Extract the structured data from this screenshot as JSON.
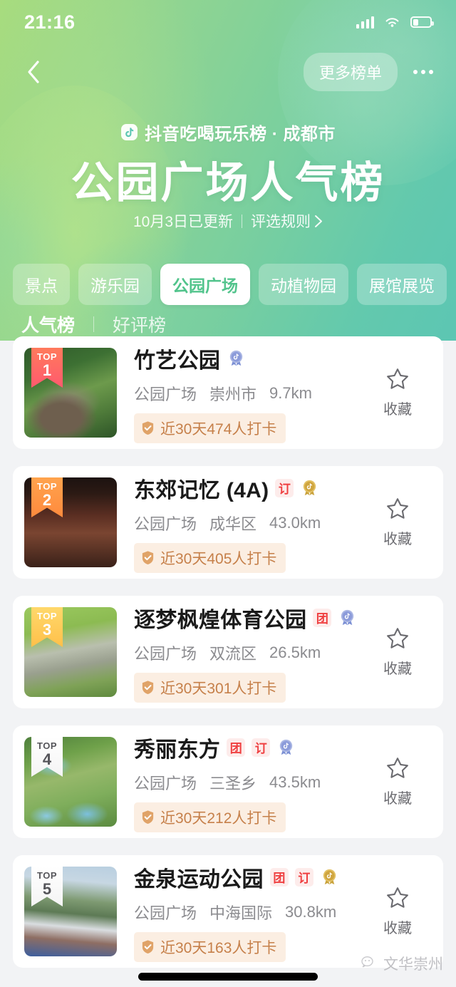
{
  "status_bar": {
    "time": "21:16",
    "signal_icon": "cellular-signal-icon",
    "wifi_icon": "wifi-icon",
    "battery_icon": "battery-icon"
  },
  "nav": {
    "back_icon": "chevron-left-icon",
    "more_lists_label": "更多榜单",
    "overflow_icon": "more-horizontal-icon"
  },
  "header": {
    "brand_icon": "douyin-logo-icon",
    "brand_line": "抖音吃喝玩乐榜 · 成都市",
    "title": "公园广场人气榜",
    "update_note": "10月3日已更新",
    "rules_label": "评选规则",
    "rules_arrow_icon": "chevron-right-icon"
  },
  "category_tabs": [
    {
      "label": "景点",
      "active": false
    },
    {
      "label": "游乐园",
      "active": false
    },
    {
      "label": "公园广场",
      "active": true
    },
    {
      "label": "动植物园",
      "active": false
    },
    {
      "label": "展馆展览",
      "active": false
    }
  ],
  "sub_tabs": [
    {
      "label": "人气榜",
      "active": true
    },
    {
      "label": "好评榜",
      "active": false
    }
  ],
  "list": {
    "favorite_label": "收藏",
    "favorite_icon": "star-outline-icon",
    "stat_icon": "shield-check-icon",
    "medal_icon": "douyin-medal-icon",
    "rank_prefix": "TOP",
    "items": [
      {
        "rank": "1",
        "name": "竹艺公园",
        "tags": [],
        "has_medal": true,
        "category": "公园广场",
        "district": "崇州市",
        "distance": "9.7km",
        "stat": "近30天474人打卡",
        "rank_color_start": "#ff7a5c",
        "rank_color_end": "#ff5a6e",
        "rank_text_color": "#ffffff"
      },
      {
        "rank": "2",
        "name": "东郊记忆 (4A)",
        "tags": [
          "订"
        ],
        "has_medal": true,
        "category": "公园广场",
        "district": "成华区",
        "distance": "43.0km",
        "stat": "近30天405人打卡",
        "rank_color_start": "#ffa34d",
        "rank_color_end": "#ff8a3d",
        "rank_text_color": "#ffffff"
      },
      {
        "rank": "3",
        "name": "逐梦枫煌体育公园",
        "tags": [
          "团"
        ],
        "has_medal": true,
        "category": "公园广场",
        "district": "双流区",
        "distance": "26.5km",
        "stat": "近30天301人打卡",
        "rank_color_start": "#ffd86b",
        "rank_color_end": "#ffc04a",
        "rank_text_color": "#ffffff"
      },
      {
        "rank": "4",
        "name": "秀丽东方",
        "tags": [
          "团",
          "订"
        ],
        "has_medal": true,
        "category": "公园广场",
        "district": "三圣乡",
        "distance": "43.5km",
        "stat": "近30天212人打卡",
        "rank_color_start": "#ffffff",
        "rank_color_end": "#f4f4f4",
        "rank_text_color": "#55555a"
      },
      {
        "rank": "5",
        "name": "金泉运动公园",
        "tags": [
          "团",
          "订"
        ],
        "has_medal": true,
        "category": "公园广场",
        "district": "中海国际",
        "distance": "30.8km",
        "stat": "近30天163人打卡",
        "rank_color_start": "#ffffff",
        "rank_color_end": "#f4f4f4",
        "rank_text_color": "#55555a"
      }
    ]
  },
  "watermark": {
    "icon": "wechat-icon",
    "label": "文华崇州"
  },
  "colors": {
    "accent_green": "#52c48c",
    "tag_red": "#ef3f40",
    "stat_orange": "#c6804a",
    "page_bg": "#f2f3f5"
  }
}
